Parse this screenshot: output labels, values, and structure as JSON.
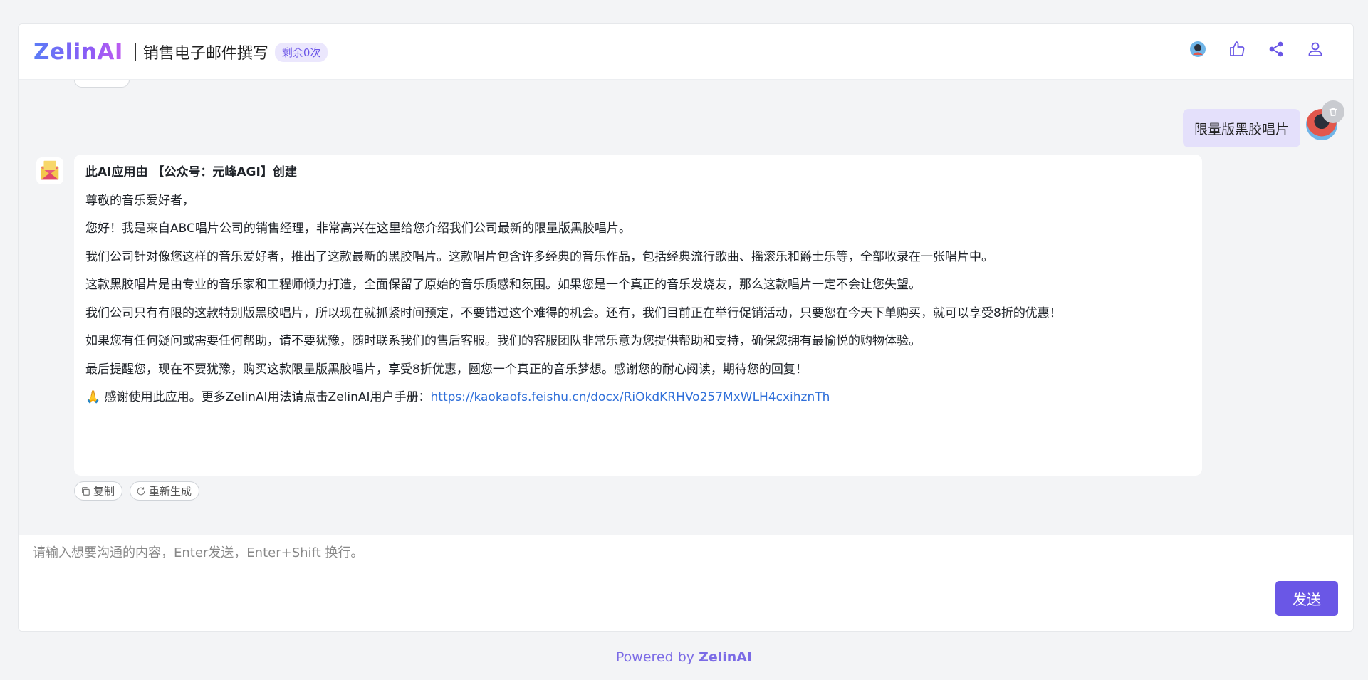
{
  "header": {
    "logo": "ZelinAI",
    "app_title": "销售电子邮件撰写",
    "quota": "剩余0次",
    "icons": [
      "avatar",
      "thumbs-up-icon",
      "share-icon",
      "user-icon"
    ]
  },
  "chat": {
    "user_message": "限量版黑胶唱片",
    "bot_message": {
      "paragraphs": [
        "此AI应用由 【公众号：元峰AGI】创建",
        "尊敬的音乐爱好者，",
        "您好！我是来自ABC唱片公司的销售经理，非常高兴在这里给您介绍我们公司最新的限量版黑胶唱片。",
        "我们公司针对像您这样的音乐爱好者，推出了这款最新的黑胶唱片。这款唱片包含许多经典的音乐作品，包括经典流行歌曲、摇滚乐和爵士乐等，全部收录在一张唱片中。",
        "这款黑胶唱片是由专业的音乐家和工程师倾力打造，全面保留了原始的音乐质感和氛围。如果您是一个真正的音乐发烧友，那么这款唱片一定不会让您失望。",
        "我们公司只有有限的这款特别版黑胶唱片，所以现在就抓紧时间预定，不要错过这个难得的机会。还有，我们目前正在举行促销活动，只要您在今天下单购买，就可以享受8折的优惠！",
        "如果您有任何疑问或需要任何帮助，请不要犹豫，随时联系我们的售后客服。我们的客服团队非常乐意为您提供帮助和支持，确保您拥有最愉悦的购物体验。",
        "最后提醒您，现在不要犹豫，购买这款限量版黑胶唱片，享受8折优惠，圆您一个真正的音乐梦想。感谢您的耐心阅读，期待您的回复！"
      ],
      "footer_text": "感谢使用此应用。更多ZelinAI用法请点击ZelinAI用户手册：",
      "footer_link": "https://kaokaofs.feishu.cn/docx/RiOkdKRHVo257MxWLH4cxihznTh"
    },
    "actions": {
      "copy": "复制",
      "regenerate": "重新生成"
    }
  },
  "input": {
    "placeholder": "请输入想要沟通的内容，Enter发送，Enter+Shift 换行。",
    "value": "",
    "send_label": "发送"
  },
  "footer": {
    "prefix": "Powered by ",
    "brand": "ZelinAI"
  },
  "colors": {
    "accent": "#6a57e6",
    "quota_bg": "#ebe7fd",
    "user_bubble": "#e4e0fb",
    "link": "#2f6fd9",
    "page_bg": "#f3f4f6"
  }
}
